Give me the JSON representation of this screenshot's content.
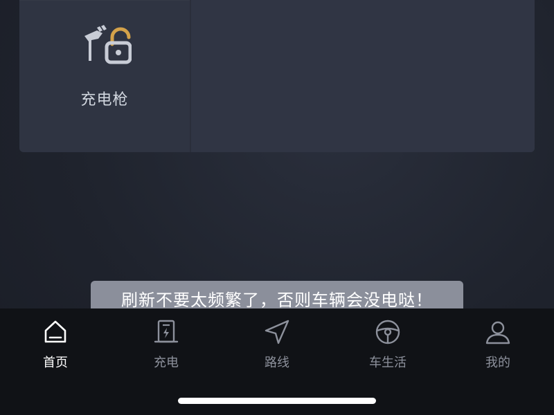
{
  "card": {
    "tiles": [
      {
        "label": "充电枪",
        "icon": "charging-gun-lock-icon"
      }
    ]
  },
  "toast": {
    "text": "刷新不要太频繁了，否则车辆会没电哒！"
  },
  "tabbar": {
    "active": "首页",
    "items": [
      {
        "label": "首页",
        "icon": "home-icon"
      },
      {
        "label": "充电",
        "icon": "charging-station-icon"
      },
      {
        "label": "路线",
        "icon": "navigation-arrow-icon"
      },
      {
        "label": "车生活",
        "icon": "steering-wheel-icon"
      },
      {
        "label": "我的",
        "icon": "user-icon"
      }
    ]
  },
  "colors": {
    "background": "#1f232d",
    "card": "#2f3442",
    "tabbar": "#101216",
    "toast": "#8b8f9b",
    "icon_accent": "#d4a24a"
  }
}
